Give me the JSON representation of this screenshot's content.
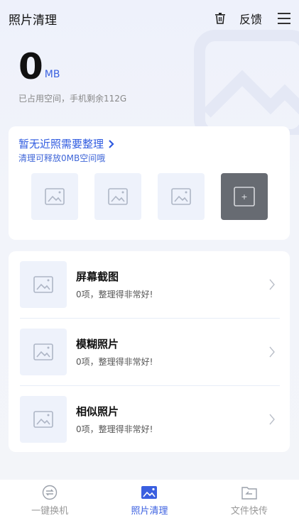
{
  "header": {
    "title": "照片清理",
    "feedback_label": "反馈"
  },
  "usage": {
    "value": "0",
    "unit": "MB",
    "subtitle": "已占用空间，手机剩余112G"
  },
  "recent": {
    "title": "暂无近照需要整理",
    "subtitle": "清理可释放0MB空间哦",
    "add_label": "+"
  },
  "categories": [
    {
      "name": "屏幕截图",
      "desc": "0项，整理得非常好!"
    },
    {
      "name": "模糊照片",
      "desc": "0项，整理得非常好!"
    },
    {
      "name": "相似照片",
      "desc": "0项，整理得非常好!"
    }
  ],
  "nav": {
    "items": [
      {
        "label": "一键换机",
        "icon": "swap-icon",
        "active": false
      },
      {
        "label": "照片清理",
        "icon": "photo-icon",
        "active": true
      },
      {
        "label": "文件快传",
        "icon": "file-transfer-icon",
        "active": false
      }
    ]
  },
  "colors": {
    "accent": "#3a5fe0",
    "thumb_bg": "#eef2fb",
    "add_bg": "#676b72"
  }
}
